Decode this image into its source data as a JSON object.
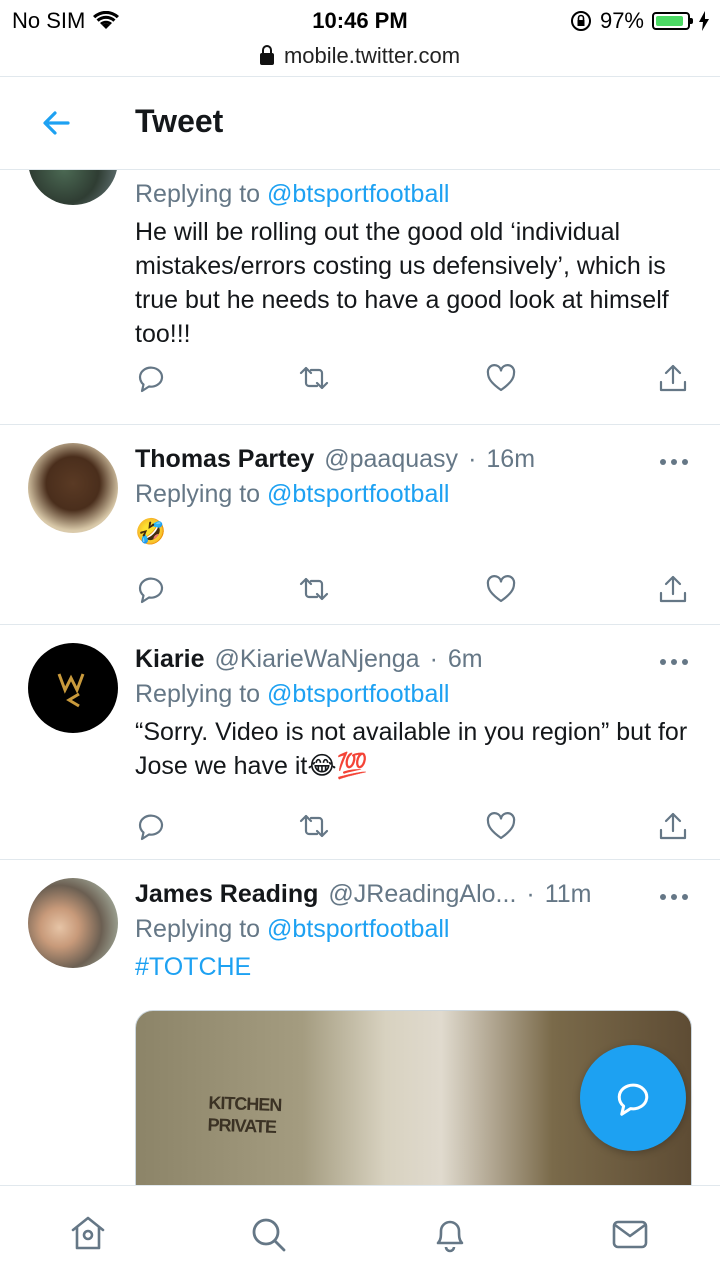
{
  "status": {
    "carrier": "No SIM",
    "time": "10:46 PM",
    "battery": "97%",
    "battery_level": 0.97
  },
  "browser": {
    "url": "mobile.twitter.com"
  },
  "header": {
    "title": "Tweet"
  },
  "tweets": [
    {
      "name": "",
      "handle": "",
      "time": "",
      "replying_prefix": "Replying to",
      "replying_to": "@btsportfootball",
      "text": "He will be rolling out the good old ‘individual mistakes/errors costing us defensively’, which is true but he needs to have a good look at himself too!!!"
    },
    {
      "name": "Thomas Partey",
      "handle": "@paaquasy",
      "dot": "·",
      "time": "16m",
      "replying_prefix": "Replying to",
      "replying_to": "@btsportfootball",
      "text": "🤣"
    },
    {
      "name": "Kiarie",
      "handle": "@KiarieWaNjenga",
      "dot": "·",
      "time": "6m",
      "replying_prefix": "Replying to",
      "replying_to": "@btsportfootball",
      "text": "“Sorry. Video is not available in you region” but for Jose we have it😂💯"
    },
    {
      "name": "James Reading",
      "handle": "@JReadingAlo...",
      "dot": "·",
      "time": "11m",
      "replying_prefix": "Replying to",
      "replying_to": "@btsportfootball",
      "text": "#TOTCHE",
      "media_sign": "KITCHEN PRIVATE"
    }
  ],
  "icons": {
    "reply": "reply-icon",
    "retweet": "retweet-icon",
    "like": "heart-icon",
    "share": "share-icon",
    "compose": "compose-icon"
  },
  "tabs": [
    "home-icon",
    "search-icon",
    "notifications-icon",
    "messages-icon"
  ],
  "colors": {
    "accent": "#1da1f2",
    "muted": "#657786",
    "text": "#14171a",
    "divider": "#e1e8ed"
  }
}
